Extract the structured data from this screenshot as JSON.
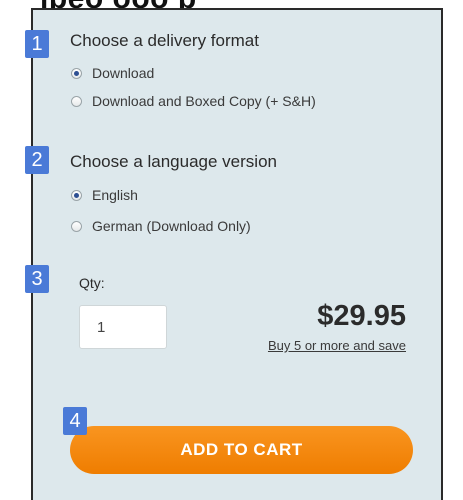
{
  "top_fragment": "ipeo  ooo  p",
  "steps": {
    "one": {
      "badge": "1",
      "title": "Choose a delivery format",
      "options": [
        {
          "label": "Download",
          "checked": true
        },
        {
          "label": "Download and Boxed Copy (+ S&H)",
          "checked": false
        }
      ]
    },
    "two": {
      "badge": "2",
      "title": "Choose a language version",
      "options": [
        {
          "label": "English",
          "checked": true
        },
        {
          "label": "German (Download Only)",
          "checked": false
        }
      ]
    },
    "three": {
      "badge": "3",
      "qty_label": "Qty:",
      "qty_value": "1",
      "price": "$29.95",
      "save_link": "Buy 5 or more and save"
    },
    "four": {
      "badge": "4",
      "button_label": "ADD TO CART"
    }
  },
  "colors": {
    "panel_bg": "#dde8ec",
    "badge_bg": "#4a7ad7",
    "button_orange": "#f58b10"
  }
}
